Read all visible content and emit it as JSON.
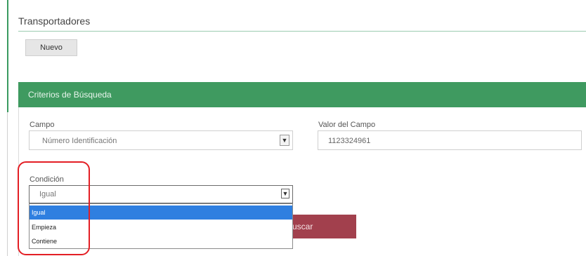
{
  "page": {
    "title": "Transportadores"
  },
  "toolbar": {
    "new_label": "Nuevo"
  },
  "search_panel": {
    "header": "Criterios de Búsqueda",
    "campo": {
      "label": "Campo",
      "selected": "Número Identificación"
    },
    "valor": {
      "label": "Valor del Campo",
      "value": "1123324961"
    },
    "condicion": {
      "label": "Condición",
      "selected": "Igual",
      "options": [
        "Igual",
        "Empieza",
        "Contiene"
      ],
      "highlighted_option": "Igual"
    },
    "search_button_label": "uscar"
  },
  "colors": {
    "panel_header": "#3f9a60",
    "search_button": "#a2404d",
    "dropdown_highlight": "#2f7fe0",
    "annotation_outline": "#e31e24"
  },
  "icons": {
    "select_caret": "chevron-down-icon"
  }
}
